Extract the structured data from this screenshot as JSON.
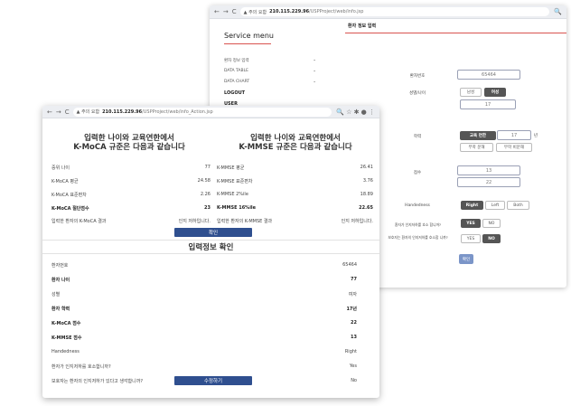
{
  "back_window": {
    "chrome": {
      "nav_icons": [
        "←",
        "→",
        "C"
      ],
      "warning": "▲ 주의 요함",
      "host": "210.115.229.96",
      "path": "/USPProject/web/info.jsp",
      "search_icon": "🔍"
    },
    "sidebar": {
      "title": "Service menu",
      "items": [
        {
          "label": "환자 정보 입력",
          "chevron": "⌄"
        },
        {
          "label": "DATA TABLE",
          "chevron": "⌄"
        },
        {
          "label": "DATA CHART",
          "chevron": "⌄"
        },
        {
          "label": "LOGOUT",
          "chevron": ""
        },
        {
          "label": "USER",
          "chevron": ""
        }
      ]
    },
    "form": {
      "header_title": "환자 정보 입력",
      "patient_id_label": "환자번호",
      "patient_id_placeholder": "65464",
      "gender_age_label": "성별/나이",
      "gender_male": "남성",
      "gender_female": "여성",
      "age_placeholder": "17",
      "education_label": "학력",
      "education_button": "교육 연한",
      "education_years_placeholder": "17",
      "education_unit": "년",
      "illiterate_btn": "무학 문해",
      "non_literate_btn": "무학 비문해",
      "score_label": "점수",
      "score1_placeholder": "13",
      "score2_placeholder": "22",
      "handedness_label": "Handedness",
      "handed_right": "Right",
      "handed_left": "Left",
      "handed_both": "Both",
      "q1_label": "환자가 인지저하를 호소 합니까?",
      "q1_yes": "YES",
      "q1_no": "NO",
      "q2_label": "보호자는 환자의 인지저하를 호소합 니까?",
      "q2_yes": "YES",
      "q2_no": "NO",
      "submit": "확인"
    }
  },
  "front_window": {
    "chrome": {
      "nav_icons": [
        "←",
        "→",
        "C"
      ],
      "warning": "▲ 주의 요함",
      "host": "210.115.229.96",
      "path": "/USPProject/web/info_Action.jsp",
      "right_icons": "🔍 ☆ ✱ ● ⋮"
    },
    "moca": {
      "title_line1": "입력한 나이와 교육연한에서",
      "title_line2": "K-MoCA 규준은 다음과 같습니다",
      "rows": [
        {
          "label": "중위 나이",
          "value": "77",
          "bold": false
        },
        {
          "label": "K-MoCA 평균",
          "value": "24.58",
          "bold": false
        },
        {
          "label": "K-MoCA 표준편차",
          "value": "2.26",
          "bold": false
        },
        {
          "label": "K-MoCA 절단점수",
          "value": "23",
          "bold": true
        },
        {
          "label": "입력한 환자의 K-MoCA 결과",
          "value": "인지 저하입니다.",
          "bold": false
        }
      ]
    },
    "mmse": {
      "title_line1": "입력한 나이와 교육연한에서",
      "title_line2": "K-MMSE 규준은 다음과 같습니다",
      "rows": [
        {
          "label": "K-MMSE 평균",
          "value": "26.41",
          "bold": false
        },
        {
          "label": "K-MMSE 표준편차",
          "value": "3.76",
          "bold": false
        },
        {
          "label": "K-MMSE 2%ile",
          "value": "18.89",
          "bold": false
        },
        {
          "label": "K-MMSE 16%ile",
          "value": "22.65",
          "bold": true
        },
        {
          "label": "입력한 환자의 K-MMSE 결과",
          "value": "인지 저하입니다.",
          "bold": false
        }
      ]
    },
    "confirm_button": "확인",
    "input_check": {
      "title": "입력정보 확인",
      "rows": [
        {
          "label": "환자번호",
          "value": "65464",
          "bold": false
        },
        {
          "label": "환자 나이",
          "value": "77",
          "bold": true
        },
        {
          "label": "성별",
          "value": "여자",
          "bold": false
        },
        {
          "label": "환자 학력",
          "value": "17년",
          "bold": true
        },
        {
          "label": "K-MoCA 점수",
          "value": "22",
          "bold": true
        },
        {
          "label": "K-MMSE 점수",
          "value": "13",
          "bold": true
        },
        {
          "label": "Handedness",
          "value": "Right",
          "bold": false
        },
        {
          "label": "환자가 인지저하를 호소합니까?",
          "value": "Yes",
          "bold": false
        },
        {
          "label": "보호자는 환자의 인지저하가 있다고 생각합니까?",
          "value": "No",
          "bold": false
        }
      ]
    },
    "edit_button": "수정하기"
  }
}
